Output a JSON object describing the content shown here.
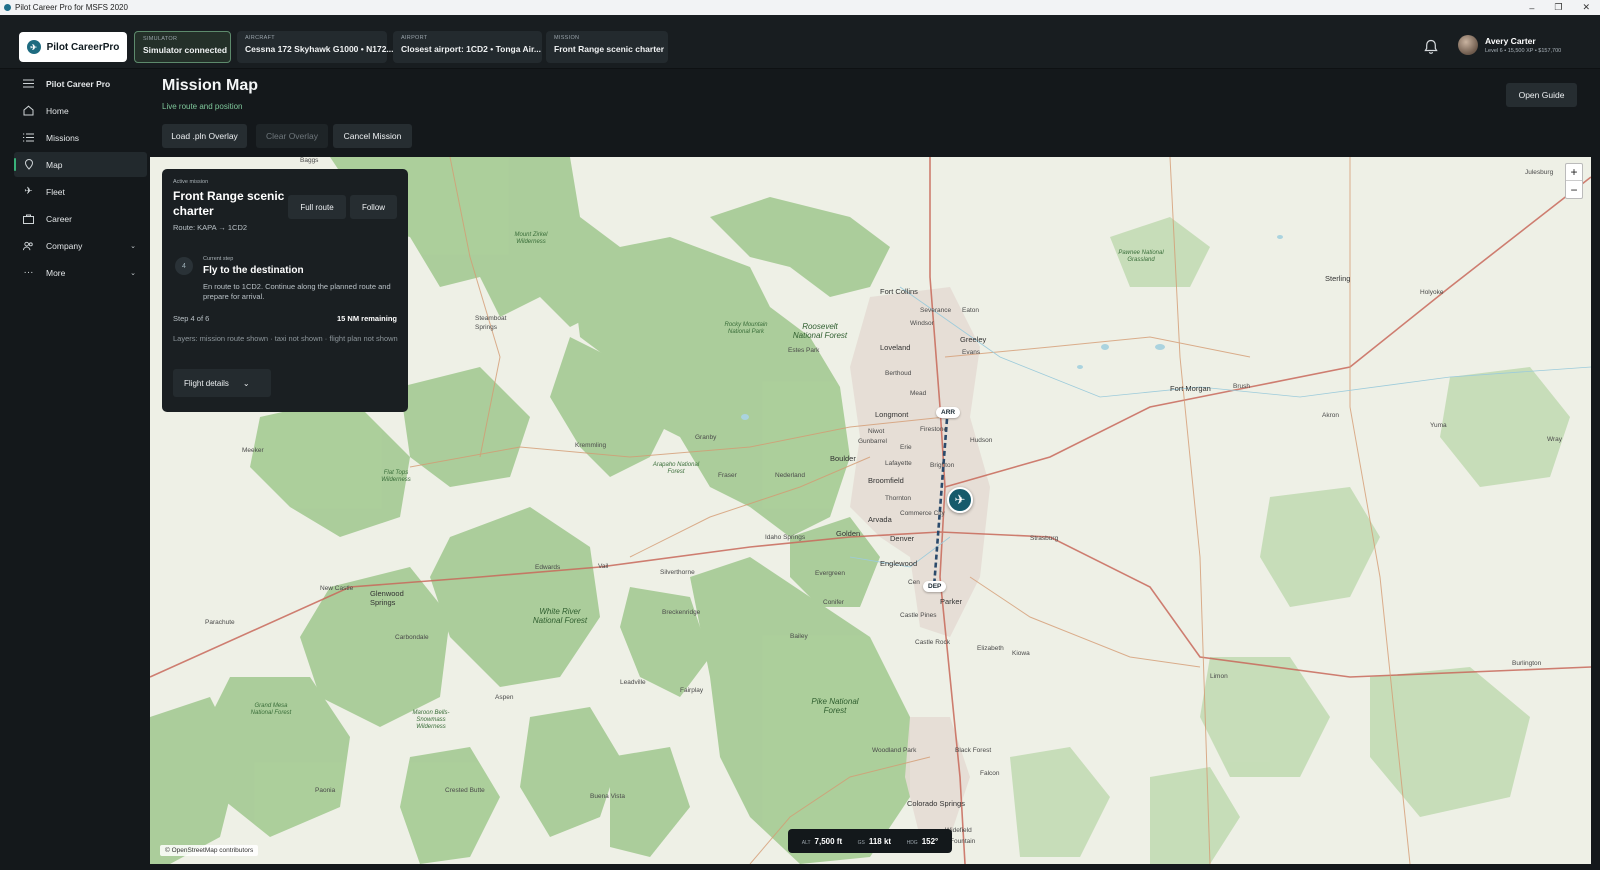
{
  "window": {
    "title": "Pilot Career Pro for MSFS 2020"
  },
  "header": {
    "brand": "Pilot CareerPro",
    "chips": {
      "simulator": {
        "label": "SIMULATOR",
        "value": "Simulator connected"
      },
      "aircraft": {
        "label": "AIRCRAFT",
        "value": "Cessna 172 Skyhawk G1000 • N172..."
      },
      "airport": {
        "label": "AIRPORT",
        "value": "Closest airport: 1CD2 • Tonga Air..."
      },
      "mission": {
        "label": "MISSION",
        "value": "Front Range scenic charter"
      }
    },
    "user": {
      "name": "Avery Carter",
      "meta": "Level 6 • 15,500 XP • $157,700"
    }
  },
  "sidebar": {
    "items": [
      {
        "label": "Pilot Career Pro",
        "icon": "menu-icon"
      },
      {
        "label": "Home",
        "icon": "home-icon"
      },
      {
        "label": "Missions",
        "icon": "list-icon"
      },
      {
        "label": "Map",
        "icon": "map-icon",
        "active": true
      },
      {
        "label": "Fleet",
        "icon": "plane-icon"
      },
      {
        "label": "Career",
        "icon": "career-icon"
      },
      {
        "label": "Company",
        "icon": "people-icon",
        "expandable": true
      },
      {
        "label": "More",
        "icon": "more-icon",
        "expandable": true
      }
    ]
  },
  "main": {
    "title": "Mission Map",
    "subtitle": "Live route and position",
    "buttons": {
      "load": "Load .pln Overlay",
      "clear": "Clear Overlay",
      "cancel": "Cancel Mission",
      "guide": "Open Guide"
    }
  },
  "panel": {
    "kicker": "Active mission",
    "title": "Front Range scenic charter",
    "route": "Route: KAPA → 1CD2",
    "full_route": "Full route",
    "follow": "Follow",
    "step_number": "4",
    "step_kicker": "Current step",
    "step_title": "Fly to the destination",
    "step_desc": "En route to 1CD2. Continue along the planned route and prepare for arrival.",
    "step_count": "Step 4 of 6",
    "remaining": "15 NM remaining",
    "layers": "Layers: mission route shown · taxi not shown · flight plan not shown",
    "details": "Flight details"
  },
  "map": {
    "zoom_in": "+",
    "zoom_out": "−",
    "attribution": "© OpenStreetMap contributors",
    "arr_tag": "ARR",
    "dep_tag": "DEP",
    "colors": {
      "route": "#2a4a6b",
      "plane": "#165a6b",
      "forest": "#9cc08c",
      "road": "#c85a4a"
    },
    "labels": {
      "baggs": "Baggs",
      "julesburg": "Julesburg",
      "zirkel": "Mount Zirkel Wilderness",
      "steamboat": "Steamboat Springs",
      "fortcollins": "Fort Collins",
      "severance": "Severance",
      "eaton": "Eaton",
      "windsor": "Windsor",
      "greeley": "Greeley",
      "evans": "Evans",
      "loveland": "Loveland",
      "berthoud": "Berthoud",
      "mead": "Mead",
      "longmont": "Longmont",
      "firestone": "Firestone",
      "hudson": "Hudson",
      "niwot": "Niwot",
      "gunbarrel": "Gunbarrel",
      "erie": "Erie",
      "boulder": "Boulder",
      "lafayette": "Lafayette",
      "brighton": "Brighton",
      "broomfield": "Broomfield",
      "thornton": "Thornton",
      "commerce": "Commerce City",
      "arvada": "Arvada",
      "golden": "Golden",
      "denver": "Denver",
      "englewood": "Englewood",
      "centennial": "Cen",
      "parker": "Parker",
      "castlepines": "Castle Pines",
      "castlerock": "Castle Rock",
      "elizabeth": "Elizabeth",
      "kiowa": "Kiowa",
      "strasburg": "Strasburg",
      "fortmorgan": "Fort Morgan",
      "brush": "Brush",
      "akron": "Akron",
      "yuma": "Yuma",
      "wray": "Wray",
      "sterling": "Sterling",
      "holyoke": "Holyoke",
      "pawnee": "Pawnee National Grassland",
      "roosevelt": "Roosevelt National Forest",
      "estes": "Estes Park",
      "rmnp": "Rocky Mountain National Park",
      "granby": "Granby",
      "kremmling": "Kremmling",
      "meeker": "Meeker",
      "flattops": "Flat Tops Wilderness",
      "arapaho": "Arapaho National Forest",
      "nederland": "Nederland",
      "idaho": "Idaho Springs",
      "evergreen": "Evergreen",
      "conifer": "Conifer",
      "bailey": "Bailey",
      "newcastle": "New Castle",
      "glenwood": "Glenwood Springs",
      "edwards": "Edwards",
      "vail": "Vail",
      "silverthorne": "Silverthorne",
      "breckenridge": "Breckenridge",
      "whiteriver": "White River National Forest",
      "carbondale": "Carbondale",
      "parachute": "Parachute",
      "aspen": "Aspen",
      "leadville": "Leadville",
      "fairplay": "Fairplay",
      "pike": "Pike National Forest",
      "woodland": "Woodland Park",
      "blackforest": "Black Forest",
      "falcon": "Falcon",
      "coloradosprings": "Colorado Springs",
      "fountain": "Fountain",
      "crested": "Crested Butte",
      "buenavista": "Buena Vista",
      "paonia": "Paonia",
      "grandmesa": "Grand Mesa National Forest",
      "maroon": "Maroon Bells-Snowmass Wilderness",
      "limon": "Limon",
      "burlington": "Burlington",
      "fraser": "Fraser",
      "widefield": "Widefield"
    }
  },
  "telemetry": {
    "alt_label": "ALT",
    "alt": "7,500 ft",
    "gs_label": "GS",
    "gs": "118 kt",
    "hdg_label": "HDG",
    "hdg": "152°"
  }
}
